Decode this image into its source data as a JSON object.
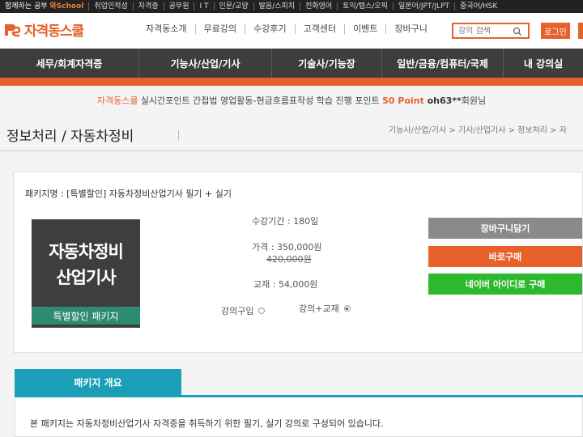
{
  "topbar": {
    "brand_prefix": "함께하는 공부",
    "brand_name": "와School",
    "items": [
      "취업인적성",
      "자격증",
      "공무원",
      "I T",
      "인문/교양",
      "발음/스피치",
      "전화영어",
      "토익/텝스/오픽",
      "일본어/JPT/JLPT",
      "중국어/HSK"
    ]
  },
  "header": {
    "logo_text": "자격동스쿨",
    "nav": [
      "자격동소개",
      "무료강의",
      "수강후기",
      "고객센터",
      "이벤트",
      "장바구니"
    ],
    "search_placeholder": "강의 검색",
    "login_label": "로그인"
  },
  "mainnav": {
    "items": [
      "세무/회계자격증",
      "기능사/산업/기사",
      "기술사/기능장",
      "일반/금융/컴퓨터/국제",
      "내 강의실"
    ]
  },
  "notice": {
    "brand": "자격동스쿨",
    "text": " 실시간포인트 간접법 영업활동-현금흐름표작성 학습 진행 포인트 ",
    "point": "50 Point",
    "user": " oh63**",
    "suffix": "회원님"
  },
  "page": {
    "title": "정보처리 / 자동차정비",
    "breadcrumb": "기능사/산업/기사 > 기사/산업기사 > 정보처리 > 자"
  },
  "package": {
    "name_line": "패키지명 : [특별할인] 자동차정비산업기사 필기 + 실기",
    "thumb_line1": "자동차정비",
    "thumb_line2": "산업기사",
    "thumb_badge": "특별할인 패키지",
    "period": "수강기간 : 180일",
    "price": "가격 : 350,000원",
    "original_price": "420,000원",
    "textbook": "교재 : 54,000원",
    "option_lecture": "강의구입",
    "option_lecture_textbook": "강의+교재",
    "selected_option": "강의+교재",
    "cart_label": "장바구니담기",
    "buy_label": "바로구매",
    "naver_label": "네이버 아이디로 구매"
  },
  "overview": {
    "tab_label": "패키지 개요",
    "text": "본 패키지는 자동차정비산업기사 자격증을 취득하기 위한 필기, 실기 강의로 구성되어 있습니다."
  },
  "colors": {
    "accent": "#e8602a",
    "nav_bg": "#3d3d3d",
    "teal": "#1b9fb8",
    "naver_green": "#2db82d",
    "cart_gray": "#8a8a8a"
  }
}
